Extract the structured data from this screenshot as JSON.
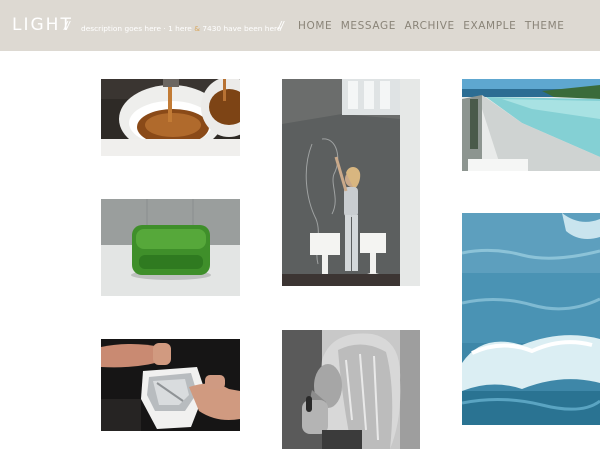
{
  "header": {
    "title": "LIGHT",
    "separator": "//",
    "description": "description goes here",
    "stats_prefix": "· 1 here",
    "stats_amp": "&",
    "stats_suffix": "7430 have been here",
    "bg_color": "#ddd9d2"
  },
  "nav": {
    "items": [
      "HOME",
      "MESSAGE",
      "ARCHIVE",
      "EXAMPLE",
      "THEME"
    ]
  },
  "gallery": [
    {
      "name": "espresso-photo",
      "icon": "coffee-cups"
    },
    {
      "name": "chalkboard-drawing-photo",
      "icon": "woman-drawing-on-wall"
    },
    {
      "name": "infinity-pool-photo",
      "icon": "pool-overlooking-sea"
    },
    {
      "name": "moss-ottoman-photo",
      "icon": "grass-cube-seat"
    },
    {
      "name": "ocean-waves-photo",
      "icon": "sea-waves"
    },
    {
      "name": "foil-hands-photo",
      "icon": "hands-with-foil"
    },
    {
      "name": "portrait-woman-photo",
      "icon": "black-and-white-portrait"
    }
  ]
}
